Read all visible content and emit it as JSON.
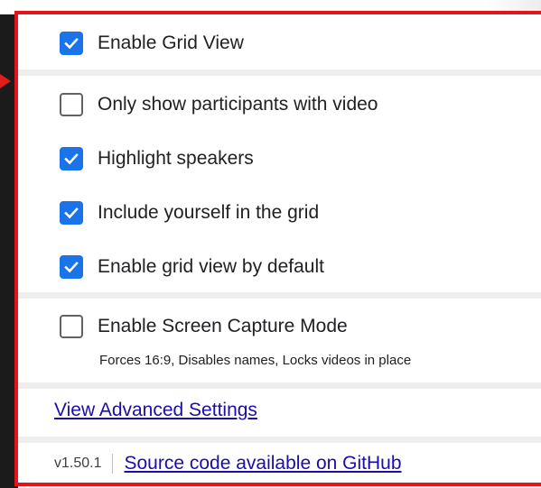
{
  "settings": {
    "enable_grid_view": {
      "label": "Enable Grid View",
      "checked": true
    },
    "only_video": {
      "label": "Only show participants with video",
      "checked": false
    },
    "highlight_speakers": {
      "label": "Highlight speakers",
      "checked": true
    },
    "include_yourself": {
      "label": "Include yourself in the grid",
      "checked": true
    },
    "grid_default": {
      "label": "Enable grid view by default",
      "checked": true
    },
    "screen_capture": {
      "label": "Enable Screen Capture Mode",
      "checked": false,
      "description": "Forces 16:9, Disables names, Locks videos in place"
    }
  },
  "links": {
    "advanced": "View Advanced Settings"
  },
  "footer": {
    "version": "v1.50.1",
    "source_link": "Source code available on GitHub"
  },
  "colors": {
    "accent": "#1a73e8",
    "highlight_frame": "#e5141a",
    "link": "#1a0dab"
  },
  "icons": {
    "checked": "checkmark-icon"
  }
}
